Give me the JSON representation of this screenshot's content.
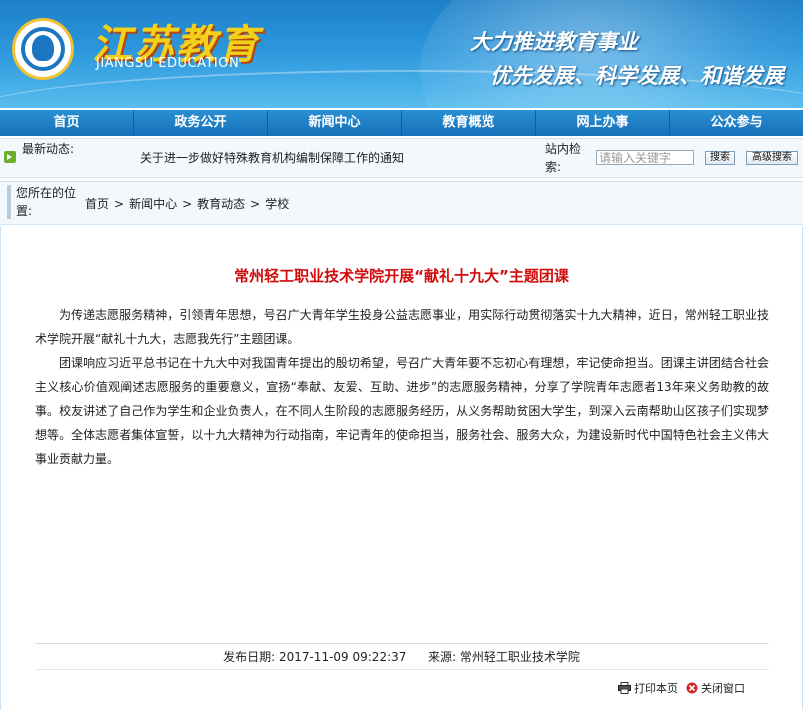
{
  "header": {
    "site_title": "江苏教育",
    "site_subtitle": "JIANGSU EDUCATION",
    "slogan_line1": "大力推进教育事业",
    "slogan_line2": "优先发展、科学发展、和谐发展",
    "colors": {
      "banner_blue": "#2c96dc",
      "title_yellow": "#f3d11a"
    }
  },
  "nav": {
    "items": [
      "首页",
      "政务公开",
      "新闻中心",
      "教育概览",
      "网上办事",
      "公众参与"
    ]
  },
  "infobar": {
    "latest_label": "最新动态:",
    "latest_news": "关于进一步做好特殊教育机构编制保障工作的通知",
    "search_label": "站内检索:",
    "search_placeholder": "请输入关键字",
    "search_button": "搜索",
    "advanced_button": "高级搜索"
  },
  "breadcrumb": {
    "label": "您所在的位置:",
    "items": [
      "首页",
      "新闻中心",
      "教育动态",
      "学校"
    ],
    "separator": ">"
  },
  "article": {
    "title": "常州轻工职业技术学院开展“献礼十九大”主题团课",
    "paragraphs": [
      "为传递志愿服务精神，引领青年思想，号召广大青年学生投身公益志愿事业，用实际行动贯彻落实十九大精神，近日，常州轻工职业技术学院开展“献礼十九大，志愿我先行”主题团课。",
      "团课响应习近平总书记在十九大中对我国青年提出的殷切希望，号召广大青年要不忘初心有理想，牢记使命担当。团课主讲团结合社会主义核心价值观阐述志愿服务的重要意义，宣扬“奉献、友爱、互助、进步”的志愿服务精神，分享了学院青年志愿者13年来义务助教的故事。校友讲述了自己作为学生和企业负责人，在不同人生阶段的志愿服务经历，从义务帮助贫困大学生，到深入云南帮助山区孩子们实现梦想等。全体志愿者集体宣誓，以十九大精神为行动指南，牢记青年的使命担当，服务社会、服务大众，为建设新时代中国特色社会主义伟大事业贡献力量。"
    ],
    "publish_label": "发布日期:",
    "publish_date": "2017-11-09 09:22:37",
    "source_label": "来源:",
    "source": "常州轻工职业技术学院",
    "title_color": "#d10a0a"
  },
  "tools": {
    "print": "打印本页",
    "close": "关闭窗口"
  }
}
